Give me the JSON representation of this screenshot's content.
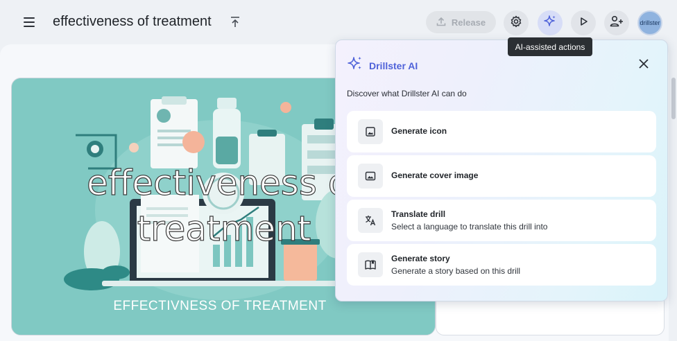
{
  "header": {
    "title": "effectiveness of treatment",
    "release_label": "Release",
    "avatar_text": "drillster"
  },
  "cover": {
    "overlay_title": "effectiveness of\ntreatment",
    "caption": "EFFECTIVNESS OF TREATMENT"
  },
  "ai_panel": {
    "heading": "Drillster AI",
    "subtitle": "Discover what Drillster AI can do",
    "items": [
      {
        "label": "Generate icon",
        "description": "",
        "icon": "image-icon"
      },
      {
        "label": "Generate cover image",
        "description": "",
        "icon": "landscape-image-icon"
      },
      {
        "label": "Translate drill",
        "description": "Select a language to translate this drill into",
        "icon": "translate-icon"
      },
      {
        "label": "Generate story",
        "description": "Generate a story based on this drill",
        "icon": "book-icon"
      }
    ]
  },
  "tooltip": {
    "text": "AI-assisted actions"
  },
  "colors": {
    "accent": "#4f62d9",
    "cover_bg": "#7fc8c2",
    "tooltip_bg": "#2b2f33"
  }
}
